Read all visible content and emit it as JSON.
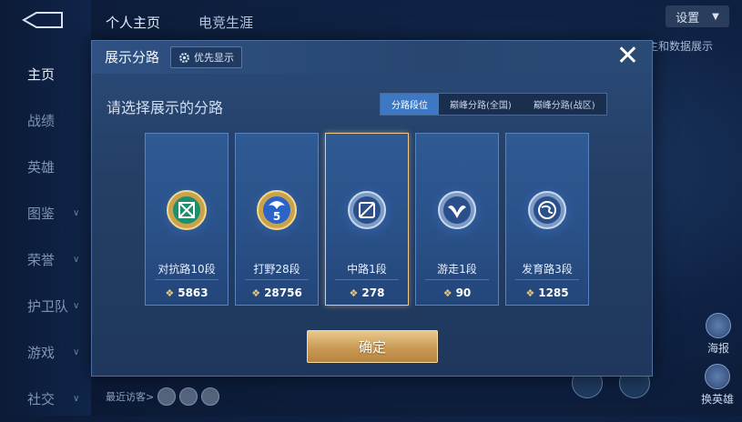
{
  "header": {
    "tabs": [
      "个人主页",
      "电竞生涯"
    ],
    "settings_label": "设置",
    "corner_text": "主和数据展示"
  },
  "sidebar": {
    "items": [
      {
        "label": "主页"
      },
      {
        "label": "战绩"
      },
      {
        "label": "英雄"
      },
      {
        "label": "图鉴"
      },
      {
        "label": "荣誉"
      },
      {
        "label": "护卫队"
      },
      {
        "label": "游戏"
      },
      {
        "label": "社交"
      }
    ]
  },
  "right_buttons": [
    {
      "label": "海报"
    },
    {
      "label": "换英雄"
    }
  ],
  "footer": {
    "recent_visitors": "最近访客>"
  },
  "modal": {
    "title": "展示分路",
    "priority_label": "优先显示",
    "close_icon": "close-icon",
    "subtitle": "请选择展示的分路",
    "tabs": [
      "分路段位",
      "巅峰分路(全国)",
      "巅峰分路(战区)"
    ],
    "active_tab": 0,
    "cards": [
      {
        "name": "对抗路10段",
        "score": "5863",
        "icon": "clash-lane-emblem",
        "color": "#2fbf8f",
        "selected": false
      },
      {
        "name": "打野28段",
        "score": "28756",
        "icon": "jungle-emblem",
        "color": "#3a7fe0",
        "selected": false
      },
      {
        "name": "中路1段",
        "score": "278",
        "icon": "mid-lane-emblem",
        "color": "#3f74c8",
        "selected": true
      },
      {
        "name": "游走1段",
        "score": "90",
        "icon": "roam-emblem",
        "color": "#3f74c8",
        "selected": false
      },
      {
        "name": "发育路3段",
        "score": "1285",
        "icon": "farm-lane-emblem",
        "color": "#3f74c8",
        "selected": false
      }
    ],
    "confirm_label": "确定"
  },
  "colors": {
    "accent_gold": "#e8c77a",
    "active_tab": "#3c78c4",
    "selected_border": "#f0c88e"
  }
}
